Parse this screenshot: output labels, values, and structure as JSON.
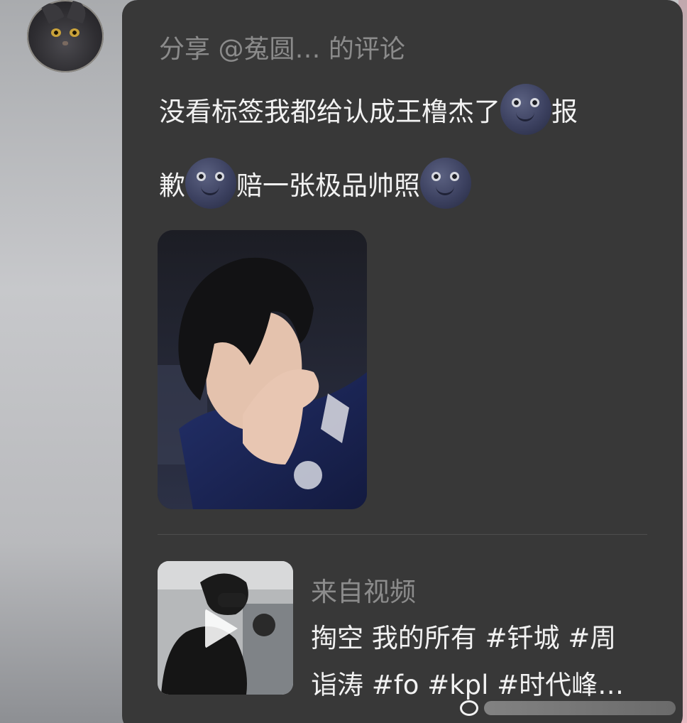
{
  "share_header": {
    "text": "分享 @菟圆… 的评论"
  },
  "comment": {
    "line1_text": "没看标签我都给认成王橹杰了",
    "line1_tail": "报",
    "line2_head": "歉",
    "line2_text": "赔一张极品帅照",
    "emoji_icon": "new-moon-face-icon"
  },
  "source": {
    "label": "来自视频",
    "title_lines": [
      "掏空 我的所有 #钎城 #周",
      "诣涛 #fo #kpl #时代峰…"
    ]
  },
  "colors": {
    "card_bg": "#383838",
    "header_text": "#8b8b8b",
    "body_text": "#f2f2f2"
  }
}
